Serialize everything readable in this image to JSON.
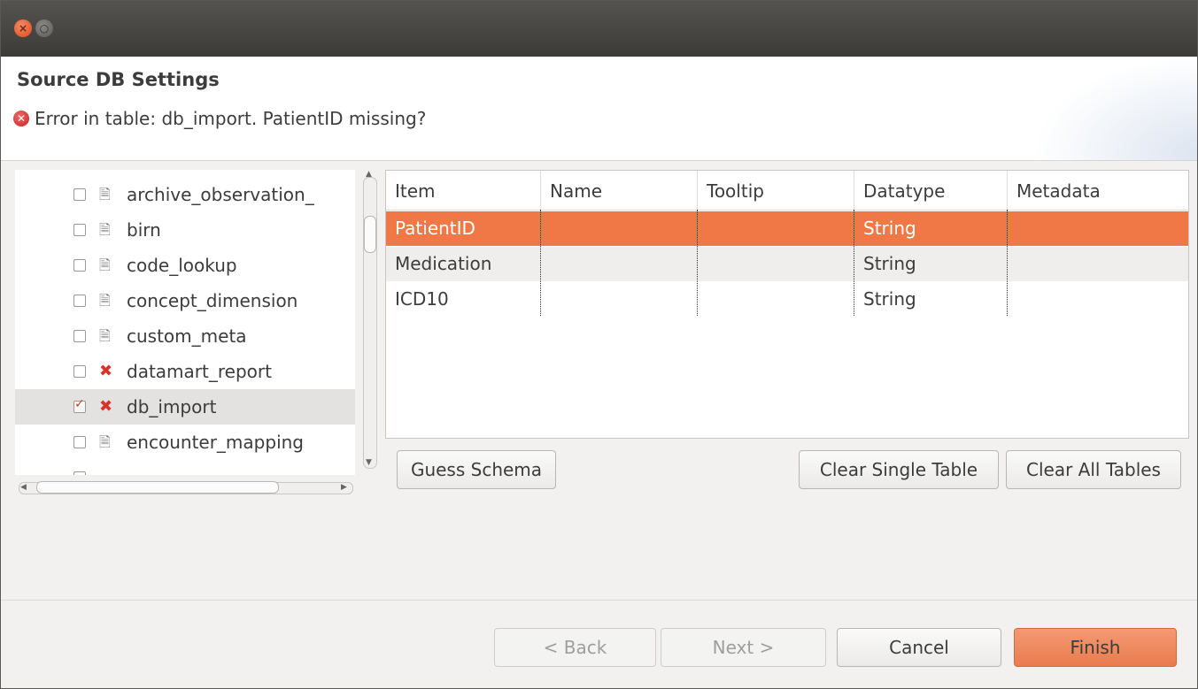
{
  "window": {
    "close_glyph": "×",
    "minimize_glyph": "○"
  },
  "header": {
    "title": "Source DB Settings",
    "message": "Error in table: db_import. PatientID missing?"
  },
  "tree": {
    "items": [
      {
        "label": "archive_observation_",
        "checked": false,
        "icon": "file-icon"
      },
      {
        "label": "birn",
        "checked": false,
        "icon": "file-icon"
      },
      {
        "label": "code_lookup",
        "checked": false,
        "icon": "file-icon"
      },
      {
        "label": "concept_dimension",
        "checked": false,
        "icon": "file-icon"
      },
      {
        "label": "custom_meta",
        "checked": false,
        "icon": "file-icon"
      },
      {
        "label": "datamart_report",
        "checked": false,
        "icon": "error-x-icon"
      },
      {
        "label": "db_import",
        "checked": true,
        "icon": "error-x-icon",
        "selected": true
      },
      {
        "label": "encounter_mapping",
        "checked": false,
        "icon": "file-icon"
      }
    ]
  },
  "table": {
    "columns": [
      "Item",
      "Name",
      "Tooltip",
      "Datatype",
      "Metadata"
    ],
    "rows": [
      {
        "item": "PatientID",
        "name": "",
        "tooltip": "",
        "datatype": "String",
        "metadata": ""
      },
      {
        "item": "Medication",
        "name": "",
        "tooltip": "",
        "datatype": "String",
        "metadata": ""
      },
      {
        "item": "ICD10",
        "name": "",
        "tooltip": "",
        "datatype": "String",
        "metadata": ""
      }
    ]
  },
  "buttons": {
    "guess_schema": "Guess Schema",
    "clear_single": "Clear Single Table",
    "clear_all": "Clear All Tables",
    "back": "< Back",
    "next": "Next >",
    "cancel": "Cancel",
    "finish": "Finish"
  },
  "colors": {
    "accent": "#f07746",
    "error": "#d8332a"
  }
}
